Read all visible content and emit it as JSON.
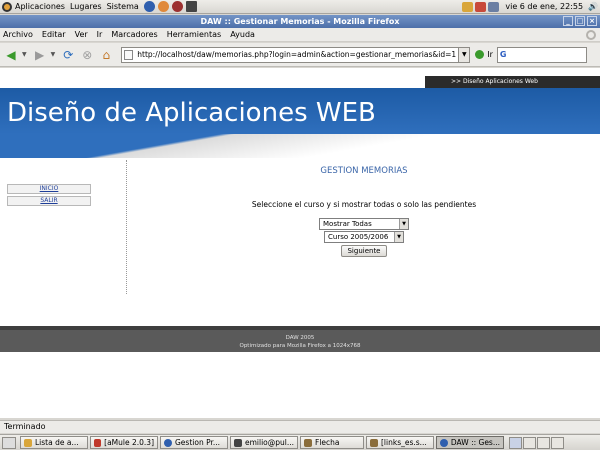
{
  "top_panel": {
    "menus": [
      "Aplicaciones",
      "Lugares",
      "Sistema"
    ],
    "clock": "vie  6 de ene, 22:55"
  },
  "window": {
    "title": "DAW :: Gestionar Memorias - Mozilla Firefox"
  },
  "menubar": {
    "items": [
      "Archivo",
      "Editar",
      "Ver",
      "Ir",
      "Marcadores",
      "Herramientas",
      "Ayuda"
    ]
  },
  "navbar": {
    "url": "http://localhost/daw/memorias.php?login=admin&action=gestionar_memorias&id=1",
    "go_label": "Ir",
    "search_placeholder": "",
    "search_logo": "G"
  },
  "page": {
    "top_strip": ">> Diseño Aplicaciones Web",
    "banner_title": "Diseño de Aplicaciones WEB",
    "sidebar": [
      {
        "label": "INICIO"
      },
      {
        "label": "SALIR"
      }
    ],
    "heading": "GESTION MEMORIAS",
    "instruction": "Seleccione el curso y si mostrar todas o solo las pendientes",
    "filter_select": {
      "selected": "Mostrar Todas"
    },
    "course_select": {
      "selected": "Curso 2005/2006"
    },
    "submit_label": "Siguiente",
    "footer_line1": "DAW 2005",
    "footer_line2": "Optimizado para Mozilla Firefox a 1024x768"
  },
  "statusbar": {
    "text": "Terminado"
  },
  "taskbar": {
    "tasks": [
      {
        "label": "Lista de a...",
        "active": false,
        "icon_color": "#d9a63a"
      },
      {
        "label": "[aMule 2.0.3]",
        "active": false,
        "icon_color": "#c0392b"
      },
      {
        "label": "Gestion Pr...",
        "active": false,
        "icon_color": "#2f5fae"
      },
      {
        "label": "emilio@pul...",
        "active": false,
        "icon_color": "#444444"
      },
      {
        "label": "Flecha",
        "active": false,
        "icon_color": "#8a6d3b"
      },
      {
        "label": "[links_es.s...",
        "active": false,
        "icon_color": "#8a6d3b"
      },
      {
        "label": "DAW :: Ges...",
        "active": true,
        "icon_color": "#2f5fae"
      }
    ]
  },
  "colors": {
    "banner": "#2f6fbd",
    "heading": "#3a65a8",
    "footer": "#5a5a5a"
  }
}
